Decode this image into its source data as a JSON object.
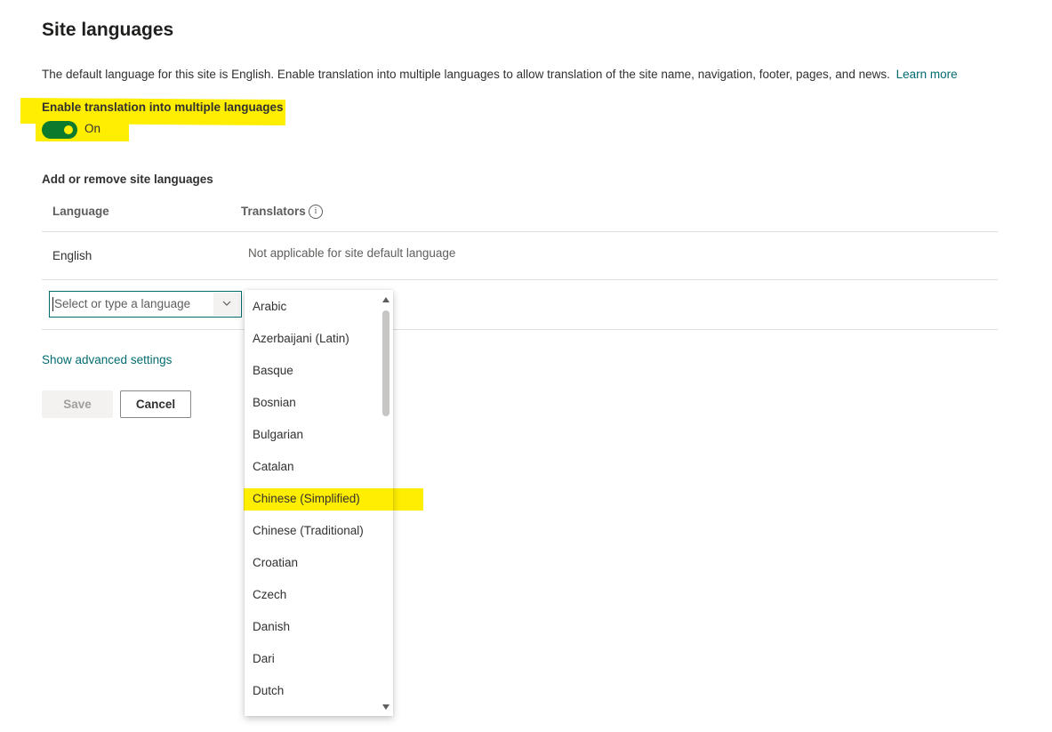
{
  "header": {
    "title": "Site languages",
    "description": "The default language for this site is English. Enable translation into multiple languages to allow translation of the site name, navigation, footer, pages, and news.",
    "learn_more": "Learn more"
  },
  "translation_toggle": {
    "label": "Enable translation into multiple languages",
    "state": "On"
  },
  "languages_section": {
    "label": "Add or remove site languages",
    "columns": [
      "Language",
      "Translators"
    ],
    "rows": [
      {
        "language": "English",
        "translators": "Not applicable for site default language"
      }
    ]
  },
  "language_picker": {
    "placeholder": "Select or type a language",
    "options": [
      "Arabic",
      "Azerbaijani (Latin)",
      "Basque",
      "Bosnian",
      "Bulgarian",
      "Catalan",
      "Chinese (Simplified)",
      "Chinese (Traditional)",
      "Croatian",
      "Czech",
      "Danish",
      "Dari",
      "Dutch"
    ],
    "highlighted_option": "Chinese (Simplified)"
  },
  "advanced_link": "Show advanced settings",
  "actions": {
    "save": "Save",
    "cancel": "Cancel"
  },
  "colors": {
    "accent": "#036c70",
    "toggle_on": "#0b7a2c",
    "highlighter": "#ffee00"
  }
}
